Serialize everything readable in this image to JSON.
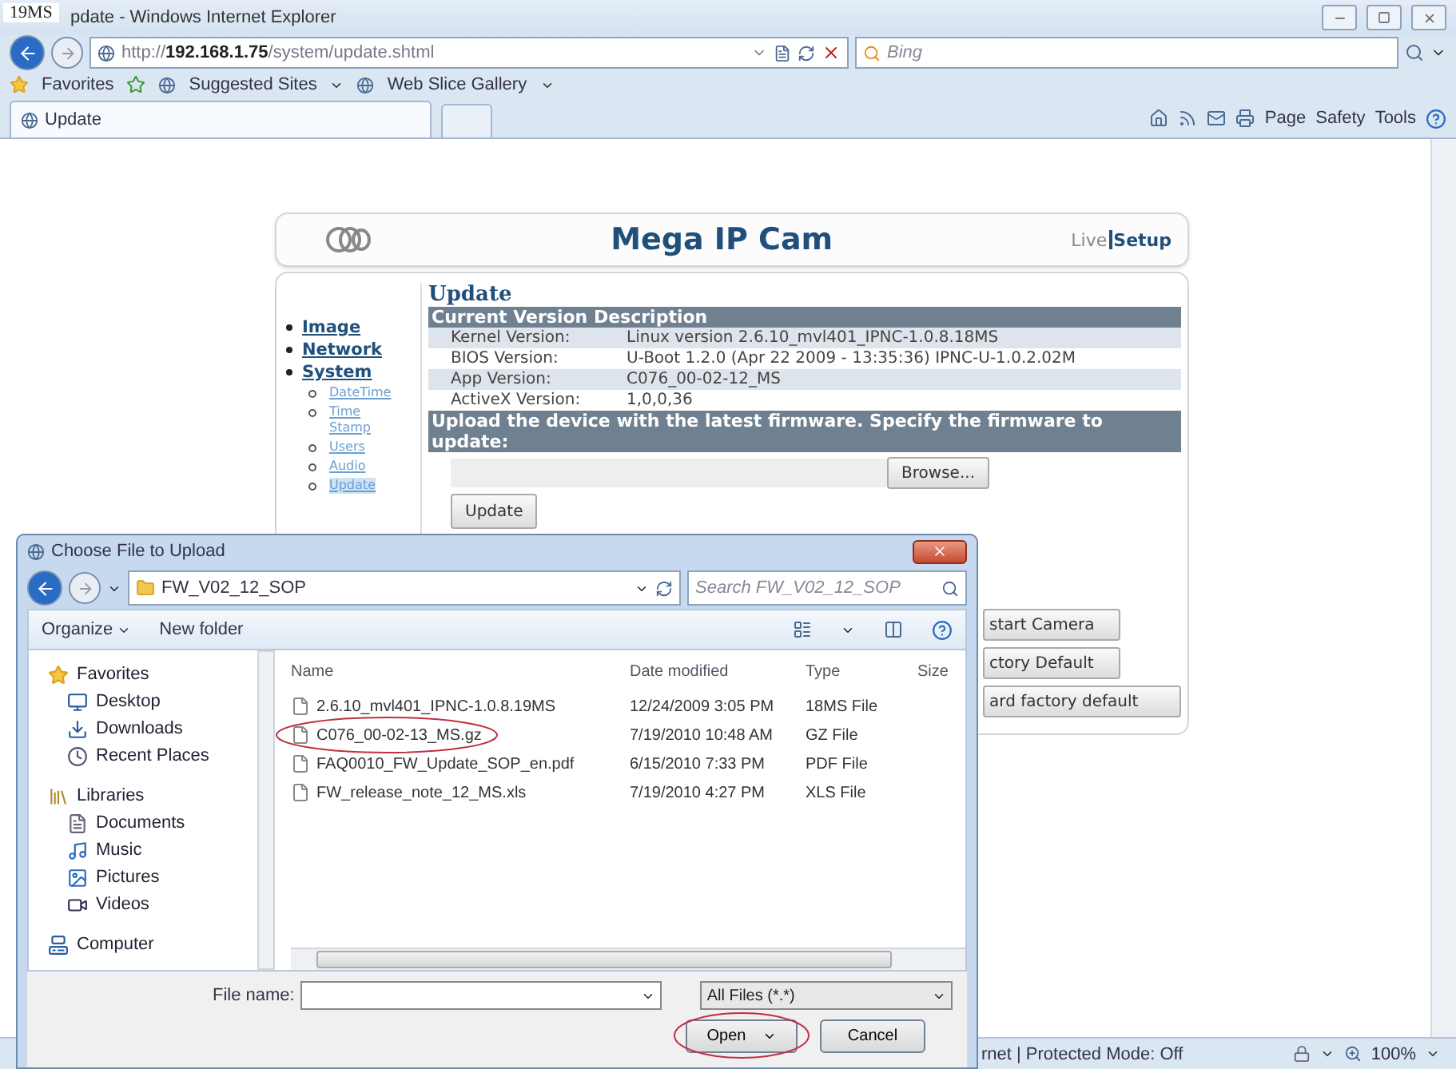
{
  "annotation_label": "19MS",
  "window": {
    "title": "pdate - Windows Internet Explorer"
  },
  "address_bar": {
    "url": "http://**192.168.1.75**/system/update.shtml",
    "search_placeholder": "Bing"
  },
  "favorites_bar": {
    "favorites": "Favorites",
    "links": [
      "Suggested Sites",
      "Web Slice Gallery"
    ]
  },
  "tab": {
    "label": "Update"
  },
  "command_bar": [
    "Page",
    "Safety",
    "Tools"
  ],
  "page": {
    "header": {
      "title": "Mega IP Cam",
      "live": "Live",
      "setup": "Setup"
    },
    "nav": [
      {
        "label": "Image"
      },
      {
        "label": "Network"
      },
      {
        "label": "System",
        "children": [
          {
            "label": "DateTime",
            "selected": false
          },
          {
            "label": "Time Stamp",
            "selected": false
          },
          {
            "label": "Users",
            "selected": false
          },
          {
            "label": "Audio",
            "selected": false
          },
          {
            "label": "Update",
            "selected": true
          }
        ]
      }
    ],
    "heading": "Update",
    "version_heading": "Current Version Description",
    "versions": [
      {
        "label": "Kernel Version:",
        "value": "Linux version 2.6.10_mvl401_IPNC-1.0.8.18MS"
      },
      {
        "label": "BIOS Version:",
        "value": "U-Boot 1.2.0 (Apr 22 2009 - 13:35:36) IPNC-U-1.0.2.02M"
      },
      {
        "label": "App Version:",
        "value": "C076_00-02-12_MS"
      },
      {
        "label": "ActiveX Version:",
        "value": "1,0,0,36"
      }
    ],
    "upload_heading": "Upload the device with the latest firmware. Specify the firmware to update:",
    "browse_button": "Browse...",
    "update_button": "Update",
    "partial_buttons": [
      "start Camera",
      "ctory Default",
      "ard factory default"
    ]
  },
  "dialog": {
    "title": "Choose File to Upload",
    "path": "FW_V02_12_SOP",
    "search_placeholder": "Search FW_V02_12_SOP",
    "toolbar": [
      "Organize",
      "New folder"
    ],
    "nav": [
      {
        "label": "Favorites",
        "children": [
          {
            "label": "Desktop"
          },
          {
            "label": "Downloads"
          },
          {
            "label": "Recent Places"
          }
        ]
      },
      {
        "label": "Libraries",
        "children": [
          {
            "label": "Documents"
          },
          {
            "label": "Music"
          },
          {
            "label": "Pictures"
          },
          {
            "label": "Videos"
          }
        ]
      },
      {
        "label": "Computer"
      }
    ],
    "columns": [
      "Name",
      "Date modified",
      "Type",
      "Size"
    ],
    "files": [
      {
        "name": "2.6.10_mvl401_IPNC-1.0.8.19MS",
        "date": "12/24/2009 3:05 PM",
        "type": "18MS File",
        "circled": false
      },
      {
        "name": "C076_00-02-13_MS.gz",
        "date": "7/19/2010 10:48 AM",
        "type": "GZ File",
        "circled": true
      },
      {
        "name": "FAQ0010_FW_Update_SOP_en.pdf",
        "date": "6/15/2010 7:33 PM",
        "type": "PDF File",
        "circled": false
      },
      {
        "name": "FW_release_note_12_MS.xls",
        "date": "7/19/2010 4:27 PM",
        "type": "XLS File",
        "circled": false
      }
    ],
    "file_name_label": "File name:",
    "filter": "All Files (*.*)",
    "open_button": {
      "label": "Open",
      "circled": true
    },
    "cancel_button": "Cancel"
  },
  "status_bar": {
    "text": "rnet | Protected Mode: Off",
    "zoom": "100%"
  }
}
